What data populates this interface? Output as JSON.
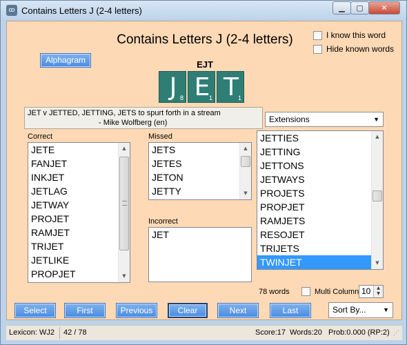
{
  "window": {
    "title": "Contains Letters J (2-4 letters)"
  },
  "main": {
    "heading": "Contains Letters J (2-4 letters)",
    "i_know_label": "I know this word",
    "hide_known_label": "Hide known words",
    "alphagram_button": "Alphagram",
    "alphagram": "EJT",
    "tiles": [
      {
        "letter": "J",
        "score": "8"
      },
      {
        "letter": "E",
        "score": "1"
      },
      {
        "letter": "T",
        "score": "1"
      }
    ],
    "definition_line1": "JET v JETTED, JETTING, JETS to spurt forth in a stream",
    "definition_line2": "- Mike Wolfberg (en)",
    "extensions_select": "Extensions"
  },
  "correct": {
    "label": "Correct",
    "items": [
      "JETE",
      "FANJET",
      "INKJET",
      "JETLAG",
      "JETWAY",
      "PROJET",
      "RAMJET",
      "TRIJET",
      "JETLIKE",
      "PROPJET"
    ]
  },
  "missed": {
    "label": "Missed",
    "items": [
      "JETS",
      "JETES",
      "JETON",
      "JETTY"
    ]
  },
  "incorrect": {
    "label": "Incorrect",
    "items": [
      "JET"
    ]
  },
  "extensions": {
    "items": [
      "JETTIES",
      "JETTING",
      "JETTONS",
      "JETWAYS",
      "PROJETS",
      "PROPJET",
      "RAMJETS",
      "RESOJET",
      "TRIJETS",
      "TWINJET"
    ],
    "selected": "TWINJET"
  },
  "list_footer": {
    "word_count": "78 words",
    "multi_column_label": "Multi Column",
    "columns": "10"
  },
  "nav": {
    "select": "Select",
    "first": "First",
    "previous": "Previous",
    "clear": "Clear",
    "next": "Next",
    "last": "Last",
    "sort_by": "Sort By..."
  },
  "status": {
    "lexicon": "Lexicon: WJ2",
    "position": "42 / 78",
    "score": "Score:17",
    "words": "Words:20",
    "prob": "Prob:0.000 (RP:2)"
  },
  "colors": {
    "client_bg": "#fdd9b5",
    "tile_bg": "#2f7e75",
    "button_blue": "#4a8be0",
    "selection": "#3399ff"
  }
}
